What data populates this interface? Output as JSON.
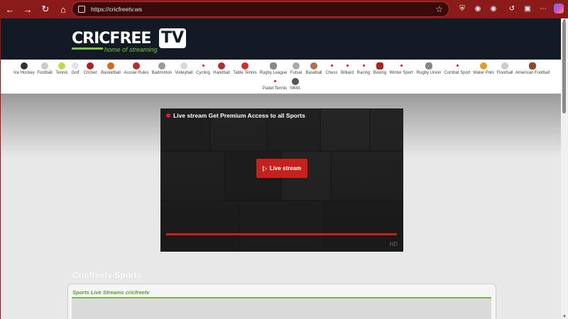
{
  "browser": {
    "url": "https://cricfreetv.ws"
  },
  "site": {
    "logo_main": "CRICFREE",
    "logo_tv": "TV",
    "logo_tagline": "home of streaming"
  },
  "sports": [
    {
      "label": "Ice Hockey",
      "color": "#333333"
    },
    {
      "label": "Football",
      "color": "#cccccc"
    },
    {
      "label": "Tennis",
      "color": "#c8d640"
    },
    {
      "label": "Golf",
      "color": "#dde6ee"
    },
    {
      "label": "Cricket",
      "color": "#b02020"
    },
    {
      "label": "Basketball",
      "color": "#d06a20"
    },
    {
      "label": "Aussie Rules",
      "color": "#b52a2a"
    },
    {
      "label": "Badminton",
      "color": "#999999"
    },
    {
      "label": "Volleyball",
      "color": "#d8d8d8"
    },
    {
      "label": "Cycling",
      "color": "#cc2222"
    },
    {
      "label": "Handball",
      "color": "#b03030"
    },
    {
      "label": "Table Tennis",
      "color": "#cc3030"
    },
    {
      "label": "Rugby League",
      "color": "#888888"
    },
    {
      "label": "Futsal",
      "color": "#aaaaaa"
    },
    {
      "label": "Baseball",
      "color": "#b07050"
    },
    {
      "label": "Chess",
      "color": "#cc2222"
    },
    {
      "label": "Billiard",
      "color": "#cc2222"
    },
    {
      "label": "Racing",
      "color": "#cc2222"
    },
    {
      "label": "Boxing",
      "color": "#b02020"
    },
    {
      "label": "Winter Sport",
      "color": "#cc2222"
    },
    {
      "label": "Rugby Union",
      "color": "#888888"
    },
    {
      "label": "Combat Sport",
      "color": "#cc2222"
    },
    {
      "label": "Water Polo",
      "color": "#e0a020"
    },
    {
      "label": "Floorball",
      "color": "#cccccc"
    },
    {
      "label": "American Football",
      "color": "#8a4a2a"
    },
    {
      "label": "Padel Tennis",
      "color": "#cc2222"
    },
    {
      "label": "MMA",
      "color": "#555555"
    }
  ],
  "player": {
    "title": "Live stream Get Premium Access to all Sports",
    "button": "Live stream",
    "badge": "HD"
  },
  "section": {
    "title": "Cricfreetv Sports",
    "card_label": "Sports Live Streams cricfreetv"
  }
}
